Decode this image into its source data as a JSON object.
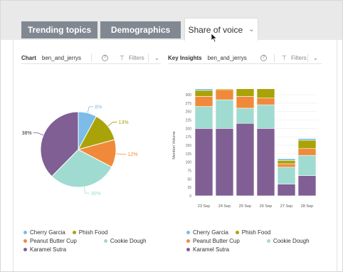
{
  "tabs": {
    "trending": "Trending topics",
    "demographics": "Demographics",
    "share": "Share of voice",
    "share_chevron": "⌄"
  },
  "left_toolbar": {
    "label": "Chart",
    "value": "ben_and_jerrys",
    "help": "?",
    "filter_icon": "filter-icon",
    "filters": "Filters",
    "caret": "⌄"
  },
  "right_toolbar": {
    "label": "Key Insights",
    "value": "ben_and_jerrys",
    "help": "?",
    "filter_icon": "filter-icon",
    "filters": "Filters",
    "caret": "⌄"
  },
  "legend_items": [
    "Cherry Garcia",
    "Phish Food",
    "Peanut Butter Cup",
    "Cookie Dough",
    "Karamel Sutra"
  ],
  "colors": {
    "Cherry Garcia": "#7bbce8",
    "Phish Food": "#a9a309",
    "Peanut Butter Cup": "#f08a3a",
    "Cookie Dough": "#9fdbd0",
    "Karamel Sutra": "#7f5f94"
  },
  "chart_data": [
    {
      "type": "pie",
      "categories": [
        "Cherry Garcia",
        "Phish Food",
        "Peanut Butter Cup",
        "Cookie Dough",
        "Karamel Sutra"
      ],
      "values": [
        8,
        13,
        12,
        30,
        38
      ],
      "labels": [
        "8%",
        "13%",
        "12%",
        "30%",
        "38%"
      ],
      "legend": "bottom"
    },
    {
      "type": "bar",
      "stacked": true,
      "categories": [
        "23 Sep",
        "24 Sep",
        "25 Sep",
        "26 Sep",
        "27 Sep",
        "28 Sep"
      ],
      "ylabel": "Mention Volume",
      "ylim": [
        0,
        300
      ],
      "yticks": [
        0,
        25,
        50,
        75,
        100,
        125,
        150,
        175,
        200,
        225,
        250,
        275,
        300
      ],
      "grid": true,
      "legend": "bottom",
      "series": [
        {
          "name": "Karamel Sutra",
          "values": [
            200,
            200,
            215,
            200,
            35,
            60
          ]
        },
        {
          "name": "Cookie Dough",
          "values": [
            65,
            85,
            45,
            70,
            50,
            60
          ]
        },
        {
          "name": "Peanut Butter Cup",
          "values": [
            30,
            30,
            35,
            20,
            10,
            20
          ]
        },
        {
          "name": "Phish Food",
          "values": [
            18,
            30,
            28,
            40,
            10,
            25
          ]
        },
        {
          "name": "Cherry Garcia",
          "values": [
            15,
            22,
            45,
            22,
            5,
            5
          ]
        }
      ]
    }
  ]
}
